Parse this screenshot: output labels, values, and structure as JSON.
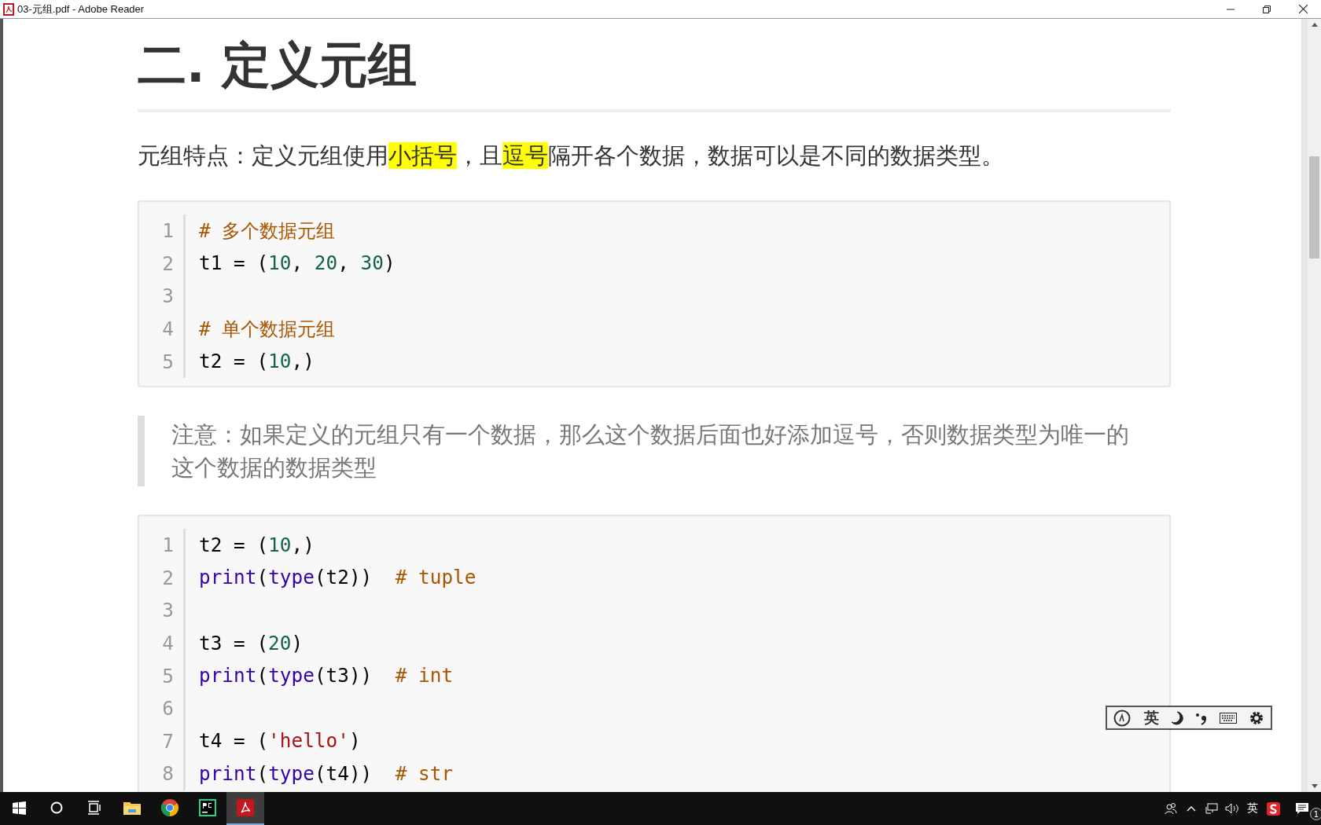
{
  "window": {
    "title": "03-元组.pdf - Adobe Reader"
  },
  "blocks": [
    {
      "kind": "heading",
      "text": "二. 定义元组"
    },
    {
      "kind": "paragraph",
      "segments": [
        {
          "text": "元组特点：定义元组使用",
          "highlighted": false
        },
        {
          "text": "小括号",
          "highlighted": true
        },
        {
          "text": "，且",
          "highlighted": false
        },
        {
          "text": "逗号",
          "highlighted": true
        },
        {
          "text": "隔开各个数据，数据可以是不同的数据类型。",
          "highlighted": false
        }
      ]
    },
    {
      "kind": "code",
      "lines": [
        {
          "number": "1",
          "tokens": [
            {
              "text": "# 多个数据元组",
              "kind": "comment"
            }
          ]
        },
        {
          "number": "2",
          "tokens": [
            {
              "text": "t1 = (",
              "kind": "plain"
            },
            {
              "text": "10",
              "kind": "number"
            },
            {
              "text": ", ",
              "kind": "plain"
            },
            {
              "text": "20",
              "kind": "number"
            },
            {
              "text": ", ",
              "kind": "plain"
            },
            {
              "text": "30",
              "kind": "number"
            },
            {
              "text": ")",
              "kind": "plain"
            }
          ]
        },
        {
          "number": "3"
        },
        {
          "number": "4",
          "tokens": [
            {
              "text": "# 单个数据元组",
              "kind": "comment"
            }
          ]
        },
        {
          "number": "5",
          "tokens": [
            {
              "text": "t2 = (",
              "kind": "plain"
            },
            {
              "text": "10",
              "kind": "number"
            },
            {
              "text": ",)",
              "kind": "plain"
            }
          ]
        }
      ]
    },
    {
      "kind": "quote",
      "text": "注意：如果定义的元组只有一个数据，那么这个数据后面也好添加逗号，否则数据类型为唯一的这个数据的数据类型"
    },
    {
      "kind": "code",
      "lines": [
        {
          "number": "1",
          "tokens": [
            {
              "text": "t2 = (",
              "kind": "plain"
            },
            {
              "text": "10",
              "kind": "number"
            },
            {
              "text": ",)",
              "kind": "plain"
            }
          ]
        },
        {
          "number": "2",
          "tokens": [
            {
              "text": "print",
              "kind": "builtin"
            },
            {
              "text": "(",
              "kind": "plain"
            },
            {
              "text": "type",
              "kind": "builtin"
            },
            {
              "text": "(t2))  ",
              "kind": "plain"
            },
            {
              "text": "# tuple",
              "kind": "comment"
            }
          ]
        },
        {
          "number": "3"
        },
        {
          "number": "4",
          "tokens": [
            {
              "text": "t3 = (",
              "kind": "plain"
            },
            {
              "text": "20",
              "kind": "number"
            },
            {
              "text": ")",
              "kind": "plain"
            }
          ]
        },
        {
          "number": "5",
          "tokens": [
            {
              "text": "print",
              "kind": "builtin"
            },
            {
              "text": "(",
              "kind": "plain"
            },
            {
              "text": "type",
              "kind": "builtin"
            },
            {
              "text": "(t3))  ",
              "kind": "plain"
            },
            {
              "text": "# int",
              "kind": "comment"
            }
          ]
        },
        {
          "number": "6"
        },
        {
          "number": "7",
          "tokens": [
            {
              "text": "t4 = (",
              "kind": "plain"
            },
            {
              "text": "'hello'",
              "kind": "string"
            },
            {
              "text": ")",
              "kind": "plain"
            }
          ]
        },
        {
          "number": "8",
          "tokens": [
            {
              "text": "print",
              "kind": "builtin"
            },
            {
              "text": "(",
              "kind": "plain"
            },
            {
              "text": "type",
              "kind": "builtin"
            },
            {
              "text": "(t4))  ",
              "kind": "plain"
            },
            {
              "text": "# str",
              "kind": "comment"
            }
          ]
        }
      ]
    }
  ],
  "ime_toolbar": {
    "mode": "英"
  },
  "taskbar": {
    "apps": [
      {
        "kind": "explorer",
        "selected": false
      },
      {
        "kind": "chrome",
        "selected": false
      },
      {
        "kind": "pycharm",
        "selected": false
      },
      {
        "kind": "acrobat",
        "selected": true
      }
    ],
    "ime": "英",
    "notifications": "1"
  }
}
